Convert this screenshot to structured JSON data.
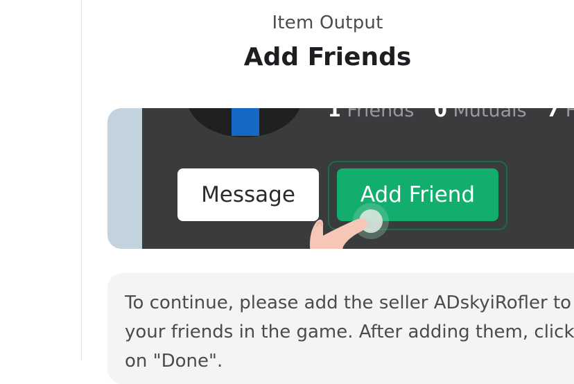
{
  "header": {
    "subtitle": "Item Output",
    "title": "Add Friends"
  },
  "profile": {
    "friends_count": "1",
    "friends_label": "Friends",
    "mutuals_count": "0",
    "mutuals_label": "Mutuals",
    "followers_count": "7",
    "followers_label": "Fo"
  },
  "actions": {
    "message_label": "Message",
    "add_friend_label": "Add Friend"
  },
  "instructions": {
    "text": "To continue, please add the seller ADskyiRofler to your friends in the game. After adding them, click on \"Done\"."
  },
  "colors": {
    "accent_green": "#12ae6e",
    "dark_panel": "#393b3d",
    "card_side": "#c3d3de"
  },
  "icons": {
    "pointer": "pointing-hand-icon",
    "tap": "tap-indicator-icon"
  }
}
